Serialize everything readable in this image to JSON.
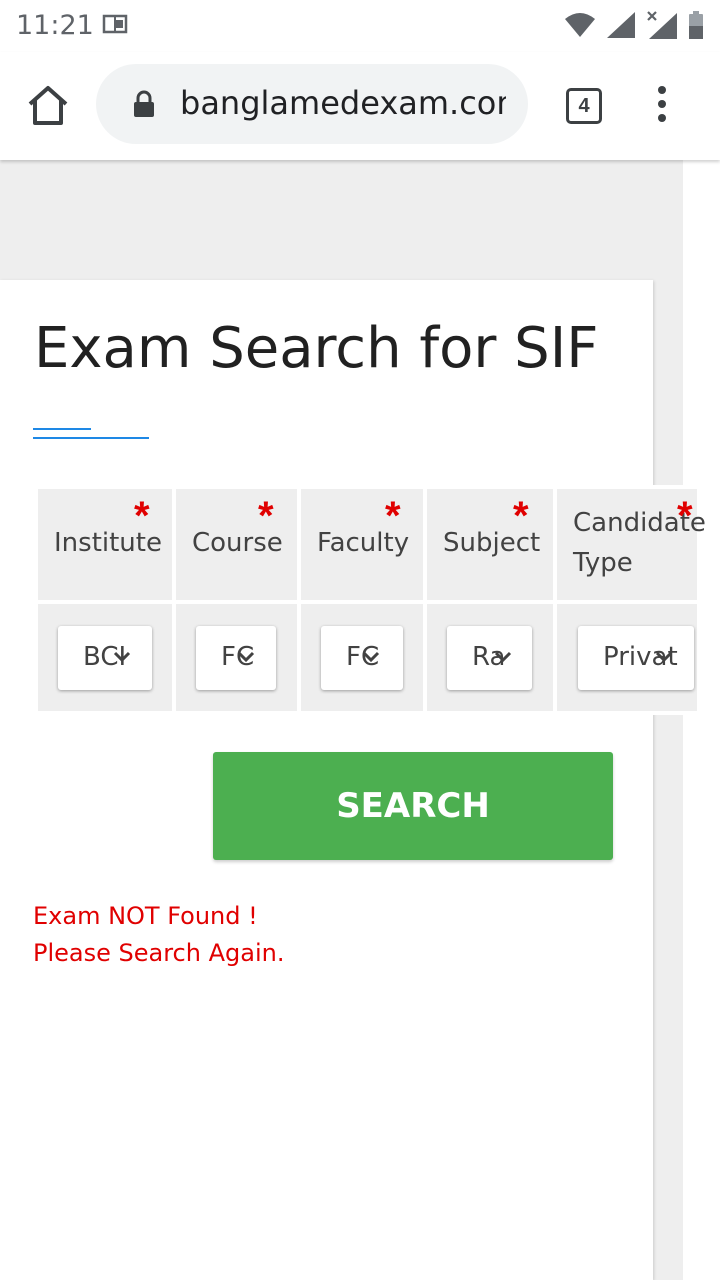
{
  "status_bar": {
    "time": "11:21"
  },
  "browser": {
    "url": "banglamedexam.com/u",
    "tab_count": "4"
  },
  "page": {
    "title": "Exam Search for SIF",
    "columns": [
      {
        "label": "Institute",
        "selected": "BCI"
      },
      {
        "label": "Course",
        "selected": "FC"
      },
      {
        "label": "Faculty",
        "selected": "FC"
      },
      {
        "label": "Subject",
        "selected": "Ra"
      },
      {
        "label": "Candidate Type",
        "line1": "Candidate",
        "line2": "Type",
        "selected": "Privat"
      }
    ],
    "required_mark": "*",
    "search_button": "SEARCH",
    "error_line1": "Exam NOT Found !",
    "error_line2": "Please Search Again."
  },
  "colors": {
    "accent": "#4caf50",
    "error": "#e00000",
    "link": "#1e88e5"
  }
}
